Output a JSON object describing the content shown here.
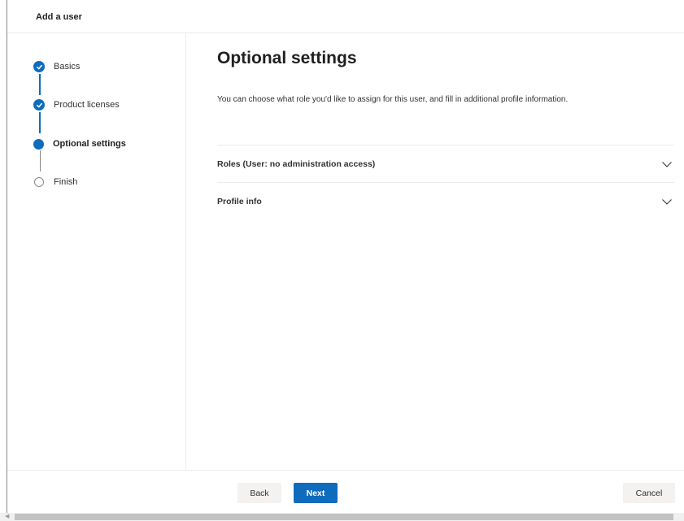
{
  "header": {
    "title": "Add a user"
  },
  "steps": [
    {
      "label": "Basics",
      "state": "completed"
    },
    {
      "label": "Product licenses",
      "state": "completed"
    },
    {
      "label": "Optional settings",
      "state": "current"
    },
    {
      "label": "Finish",
      "state": "pending"
    }
  ],
  "main": {
    "title": "Optional settings",
    "intro": "You can choose what role you'd like to assign for this user, and fill in additional profile information.",
    "sections": [
      {
        "label": "Roles (User: no administration access)",
        "icon": "chevron-down-icon"
      },
      {
        "label": "Profile info",
        "icon": "chevron-down-icon"
      }
    ]
  },
  "footer": {
    "back_label": "Back",
    "next_label": "Next",
    "cancel_label": "Cancel"
  },
  "colors": {
    "accent": "#0f6cbd",
    "pending": "#8a8886"
  }
}
